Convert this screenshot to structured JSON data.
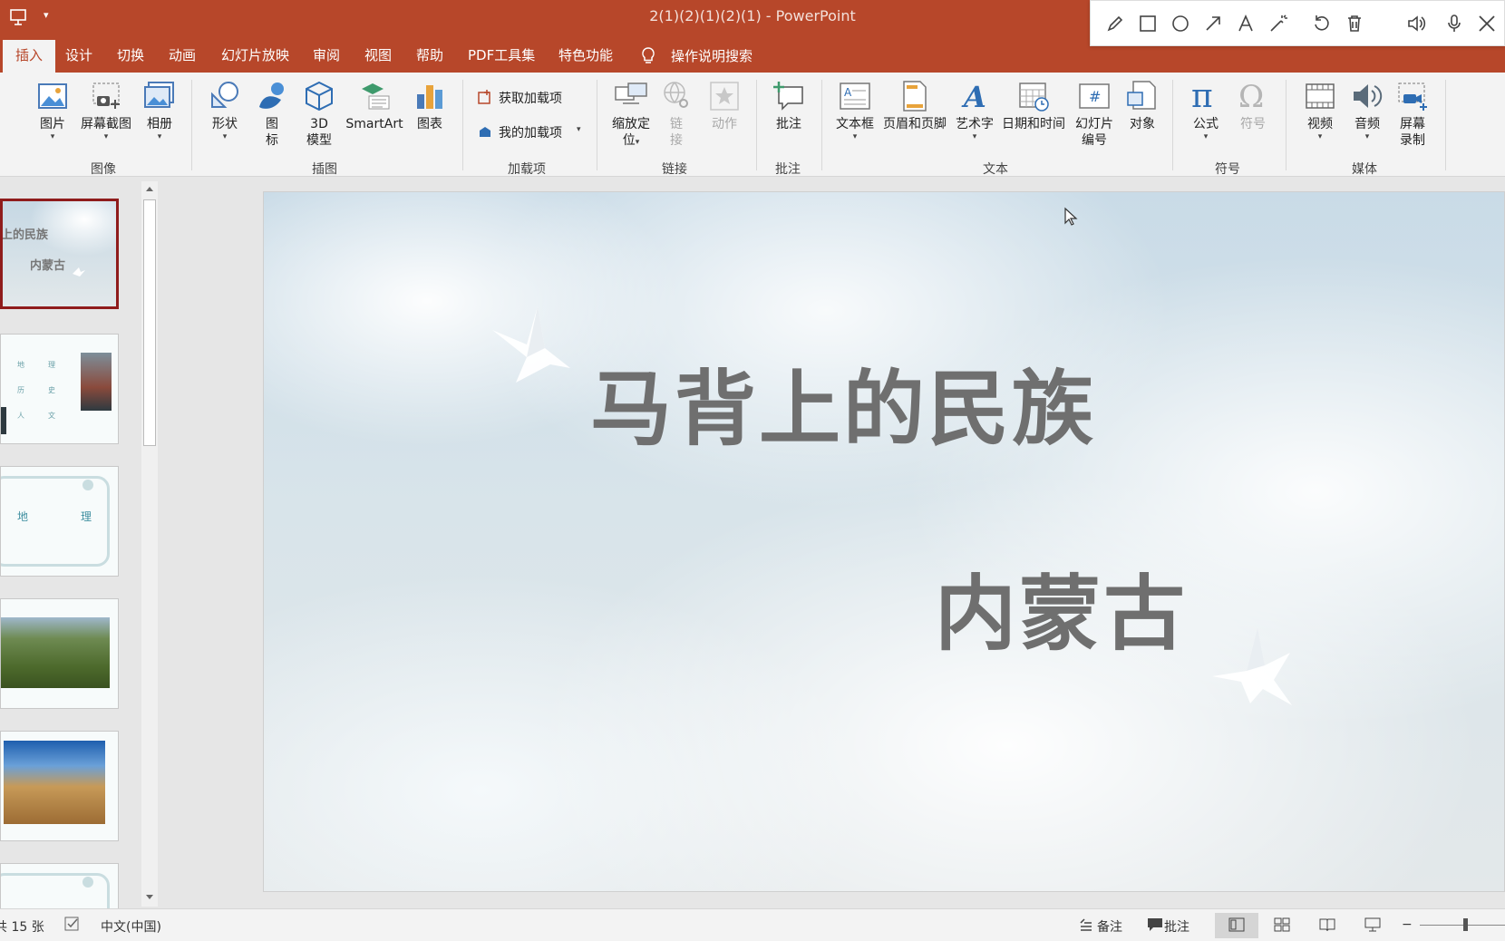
{
  "window": {
    "title": "2(1)(2)(1)(2)(1)  -  PowerPoint",
    "qat_more": "▾"
  },
  "tabs": [
    {
      "label": "插入",
      "active": true
    },
    {
      "label": "设计"
    },
    {
      "label": "切换"
    },
    {
      "label": "动画"
    },
    {
      "label": "幻灯片放映"
    },
    {
      "label": "审阅"
    },
    {
      "label": "视图"
    },
    {
      "label": "帮助"
    },
    {
      "label": "PDF工具集"
    },
    {
      "label": "特色功能"
    }
  ],
  "tell_me": "操作说明搜索",
  "ribbon": {
    "images": {
      "picture": "图片",
      "screenshot": "屏幕截图",
      "album": "相册",
      "group": "图像"
    },
    "illustrations": {
      "shapes": "形状",
      "icons_1": "图",
      "icons_2": "标",
      "model_1": "3D",
      "model_2": "模型",
      "smartart": "SmartArt",
      "chart": "图表",
      "group": "插图"
    },
    "addins": {
      "get": "获取加载项",
      "mine": "我的加载项",
      "group": "加载项"
    },
    "links": {
      "zoom_1": "缩放定",
      "zoom_2": "位",
      "link_1": "链",
      "link_2": "接",
      "action": "动作",
      "group": "链接"
    },
    "comments": {
      "comment": "批注",
      "group": "批注"
    },
    "text": {
      "textbox": "文本框",
      "header": "页眉和页脚",
      "wordart": "艺术字",
      "datetime": "日期和时间",
      "slidenum_1": "幻灯片",
      "slidenum_2": "编号",
      "object": "对象",
      "group": "文本"
    },
    "symbols": {
      "equation": "公式",
      "symbol": "符号",
      "group": "符号"
    },
    "media": {
      "video": "视频",
      "audio": "音频",
      "rec_1": "屏幕",
      "rec_2": "录制",
      "group": "媒体"
    },
    "caret": "▾"
  },
  "thumbnails": {
    "t1_title": "上的民族",
    "t1_sub": "内蒙古",
    "t2_items": [
      "地",
      "理",
      "历",
      "史",
      "人",
      "文"
    ],
    "t3_left": "地",
    "t3_right": "理"
  },
  "slide": {
    "title": "马背上的民族",
    "subtitle": "内蒙古"
  },
  "status": {
    "count": "共 15 张",
    "language": "中文(中国)",
    "notes": "备注",
    "comments": "批注",
    "zoom_minus": "−"
  },
  "colors": {
    "accent": "#b7472a",
    "selected_thumb": "#8f1c1c"
  }
}
